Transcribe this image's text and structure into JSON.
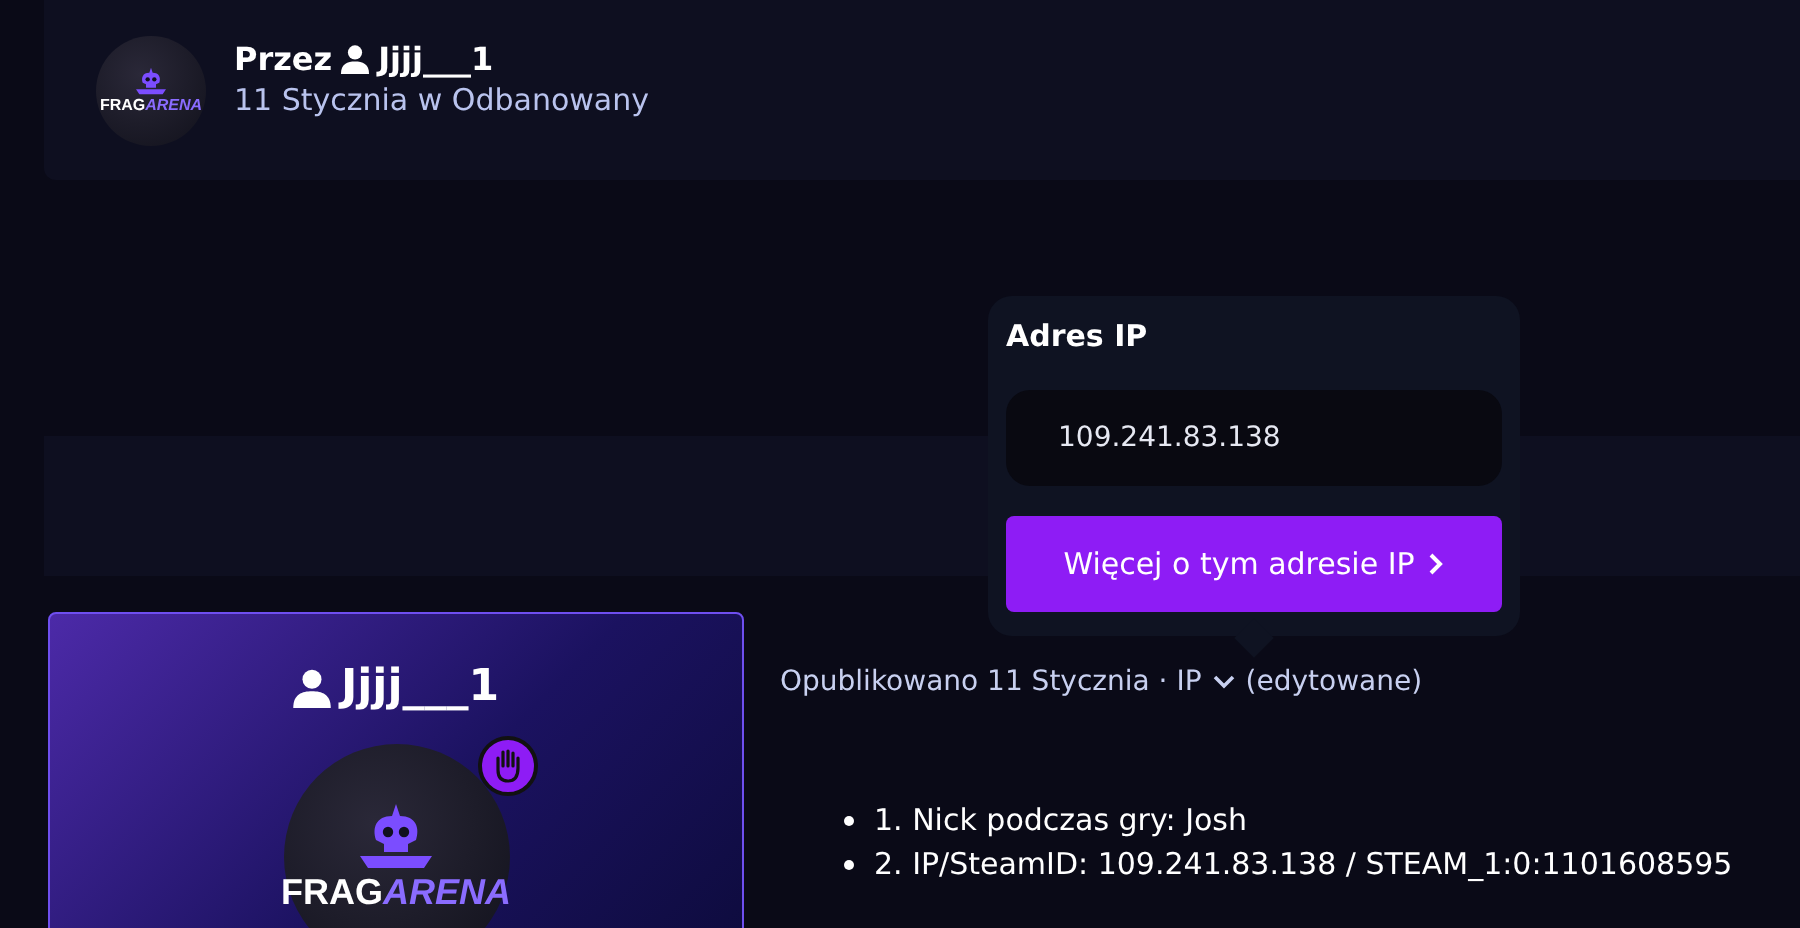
{
  "author_card": {
    "by_label": "Przez",
    "username": "Jjjj___1",
    "subtitle": "11 Stycznia w Odbanowany",
    "logo": {
      "word_1": "FRAG",
      "word_2": "ARENA"
    }
  },
  "ip_popup": {
    "title": "Adres IP",
    "value": "109.241.83.138",
    "button": "Więcej o tym adresie IP"
  },
  "profile_card": {
    "username": "Jjjj___1",
    "logo": {
      "word_1": "FRAG",
      "word_2": "ARENA"
    }
  },
  "post": {
    "meta": "Opublikowano 11 Stycznia · IP",
    "edited": "(edytowane)",
    "items": [
      {
        "text": "1. Nick podczas gry: Josh"
      },
      {
        "text": "2. IP/SteamID: 109.241.83.138 / STEAM_1:0:1101608595"
      }
    ]
  }
}
